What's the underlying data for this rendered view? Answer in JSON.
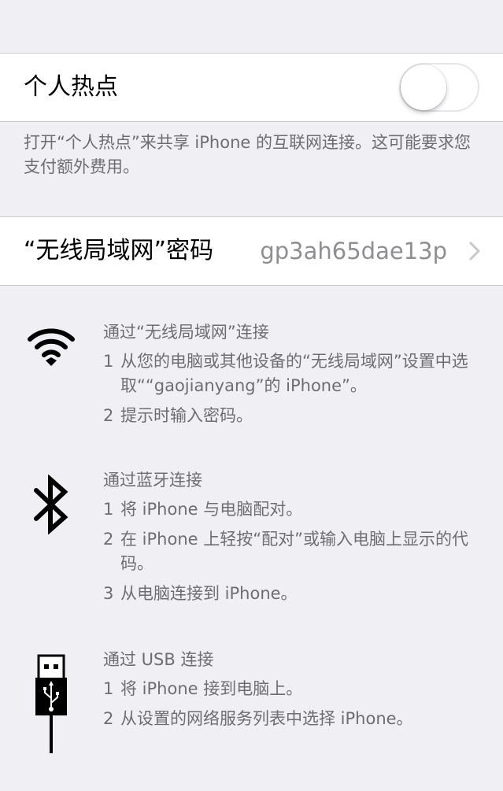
{
  "hotspot": {
    "label": "个人热点",
    "enabled": false,
    "footer": "打开“个人热点”来共享 iPhone 的互联网连接。这可能要求您支付额外费用。"
  },
  "wifi_password": {
    "label": "“无线局域网”密码",
    "value": "gp3ah65dae13p"
  },
  "connection_methods": [
    {
      "icon": "wifi-icon",
      "title": "通过“无线局域网”连接",
      "steps": [
        {
          "num": "1",
          "text": "从您的电脑或其他设备的“无线局域网”设置中选取““gaojianyang”的 iPhone”。"
        },
        {
          "num": "2",
          "text": "提示时输入密码。"
        }
      ]
    },
    {
      "icon": "bluetooth-icon",
      "title": "通过蓝牙连接",
      "steps": [
        {
          "num": "1",
          "text": "将 iPhone 与电脑配对。"
        },
        {
          "num": "2",
          "text": "在 iPhone 上轻按“配对”或输入电脑上显示的代码。"
        },
        {
          "num": "3",
          "text": "从电脑连接到 iPhone。"
        }
      ]
    },
    {
      "icon": "usb-icon",
      "title": "通过 USB 连接",
      "steps": [
        {
          "num": "1",
          "text": "将 iPhone 接到电脑上。"
        },
        {
          "num": "2",
          "text": "从设置的网络服务列表中选择 iPhone。"
        }
      ]
    }
  ]
}
